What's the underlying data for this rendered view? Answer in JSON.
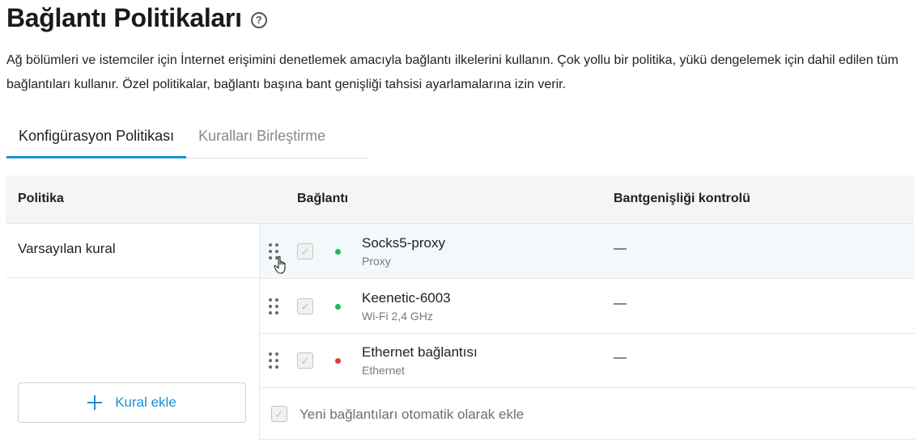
{
  "header": {
    "title": "Bağlantı Politikaları",
    "help_icon": "?",
    "description": "Ağ bölümleri ve istemciler için İnternet erişimini denetlemek amacıyla bağlantı ilkelerini kullanın. Çok yollu bir politika, yükü dengelemek için dahil edilen tüm bağlantıları kullanır. Özel politikalar, bağlantı başına bant genişliği tahsisi ayarlamalarına izin verir."
  },
  "tabs": [
    {
      "label": "Konfigürasyon Politikası",
      "active": true
    },
    {
      "label": "Kuralları Birleştirme",
      "active": false
    }
  ],
  "table": {
    "headers": {
      "policy": "Politika",
      "connection": "Bağlantı",
      "bandwidth": "Bantgenişliği kontrolü"
    }
  },
  "policies": [
    {
      "label": "Varsayılan kural"
    }
  ],
  "add_rule_label": "Kural ekle",
  "connections": [
    {
      "name": "Socks5-proxy",
      "type": "Proxy",
      "status": "online",
      "status_color": "#1db954",
      "checked": true,
      "bandwidth": "—"
    },
    {
      "name": "Keenetic-6003",
      "type": "Wi-Fi 2,4 GHz",
      "status": "online",
      "status_color": "#1db954",
      "checked": true,
      "bandwidth": "—"
    },
    {
      "name": "Ethernet bağlantısı",
      "type": "Ethernet",
      "status": "offline",
      "status_color": "#e03c31",
      "checked": true,
      "bandwidth": "—"
    }
  ],
  "auto_add": {
    "label": "Yeni bağlantıları otomatik olarak ekle",
    "checked": true
  },
  "colors": {
    "accent": "#1a8fd4",
    "online": "#1db954",
    "offline": "#e03c31",
    "highlight_row": "#f3f8fb"
  },
  "icons": {
    "help": "question-circle-icon",
    "add": "plus-icon",
    "drag": "drag-handle-icon",
    "cursor": "hand-pointer-icon"
  }
}
